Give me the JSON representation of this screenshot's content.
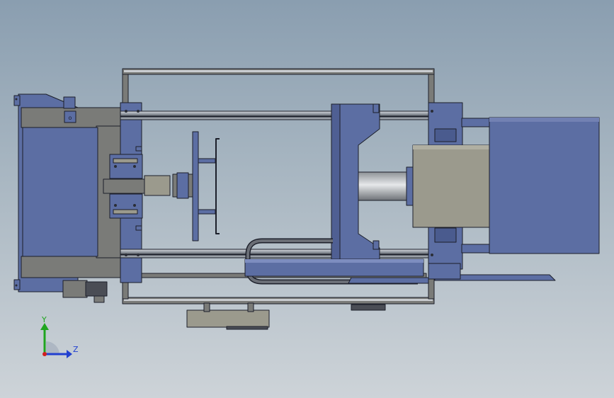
{
  "viewport": {
    "background_top": "#8a9eb0",
    "background_bottom": "#cdd3d8"
  },
  "model": {
    "frame_color": "#5c6ea3",
    "frame_dark": "#3d4a73",
    "steel_gray": "#7a7b78",
    "plate_beige": "#9b9a8d",
    "rod_color": "#b8bcc0",
    "outline_color": "#1c1f2a",
    "control_panel_label": "o"
  },
  "triad": {
    "y_label": "Y",
    "z_label": "Z",
    "y_color": "#1fa51f",
    "z_color": "#2140d0",
    "x_color": "#d01f1f"
  }
}
